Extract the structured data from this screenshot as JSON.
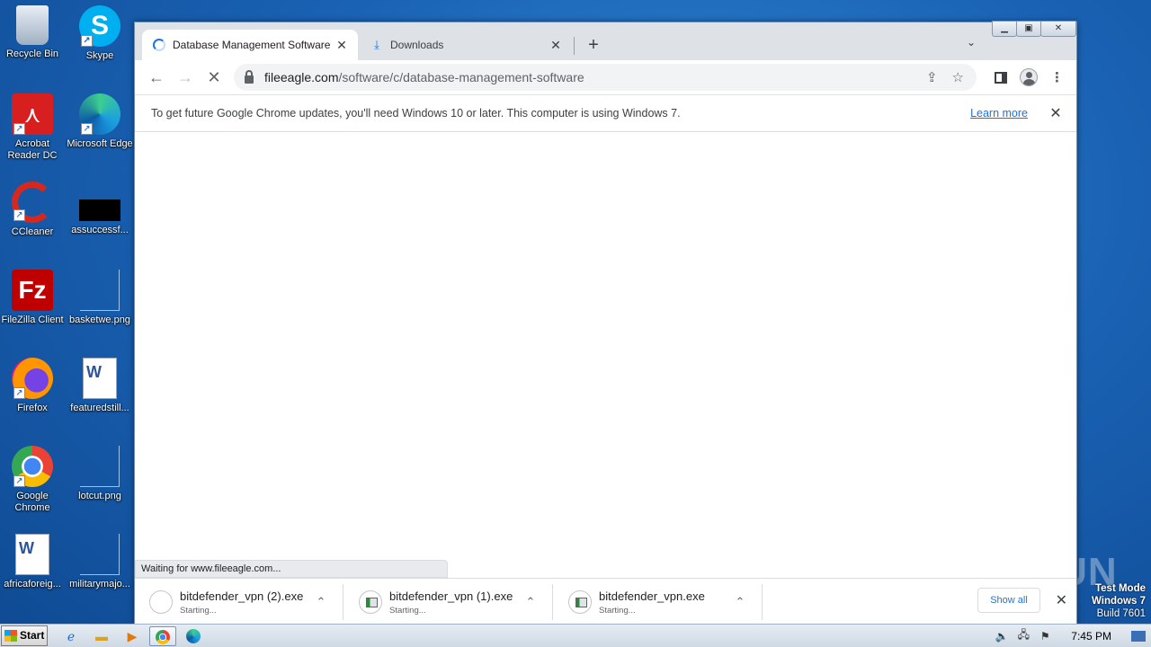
{
  "desktop": {
    "icons": [
      {
        "label": "Recycle Bin",
        "icon": "recycle-bin-icon"
      },
      {
        "label": "Skype",
        "icon": "skype-icon"
      },
      {
        "label": "Acrobat Reader DC",
        "icon": "acrobat-icon"
      },
      {
        "label": "Microsoft Edge",
        "icon": "edge-icon"
      },
      {
        "label": "CCleaner",
        "icon": "ccleaner-icon"
      },
      {
        "label": "assuccessf...",
        "icon": "black-file-icon"
      },
      {
        "label": "FileZilla Client",
        "icon": "filezilla-icon"
      },
      {
        "label": "basketwe.png",
        "icon": "image-file-icon"
      },
      {
        "label": "Firefox",
        "icon": "firefox-icon"
      },
      {
        "label": "featuredstill...",
        "icon": "word-doc-icon"
      },
      {
        "label": "Google Chrome",
        "icon": "chrome-icon"
      },
      {
        "label": "lotcut.png",
        "icon": "image-file-icon"
      },
      {
        "label": "africaforeig...",
        "icon": "word-doc-icon"
      },
      {
        "label": "militarymajo...",
        "icon": "image-file-icon"
      }
    ]
  },
  "browser": {
    "tabs": [
      {
        "title": "Database Management Software",
        "state": "loading"
      },
      {
        "title": "Downloads",
        "icon": "download-icon"
      }
    ],
    "address": {
      "host": "fileeagle.com",
      "path": "/software/c/database-management-software"
    },
    "infobar": {
      "message": "To get future Google Chrome updates, you'll need Windows 10 or later. This computer is using Windows 7.",
      "link": "Learn more"
    },
    "status": "Waiting for www.fileeagle.com...",
    "downloads": [
      {
        "name": "bitdefender_vpn (2).exe",
        "status": "Starting..."
      },
      {
        "name": "bitdefender_vpn (1).exe",
        "status": "Starting..."
      },
      {
        "name": "bitdefender_vpn.exe",
        "status": "Starting..."
      }
    ],
    "show_all": "Show all"
  },
  "watermark": "ANY RUN",
  "test_mode": {
    "line1": "Test Mode",
    "line2": "Windows 7",
    "line3": "Build 7601"
  },
  "taskbar": {
    "start": "Start",
    "clock": "7:45 PM"
  }
}
